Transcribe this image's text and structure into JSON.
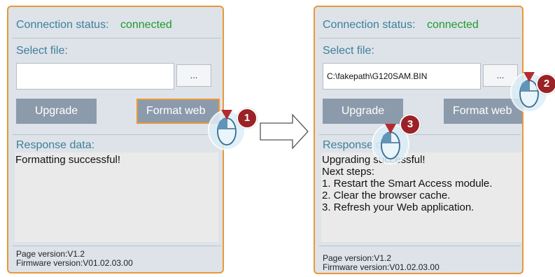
{
  "left_panel": {
    "connection_label": "Connection status:",
    "connection_value": "connected",
    "select_file_label": "Select file:",
    "file_input_value": "",
    "browse_label": "...",
    "upgrade_label": "Upgrade",
    "format_label": "Format web",
    "response_label": "Response data:",
    "response_lines": [
      "Formatting successful!"
    ],
    "page_version": "Page version:V1.2",
    "firmware_version": "Firmware version:V01.02.03.00",
    "step_badge": "1"
  },
  "right_panel": {
    "connection_label": "Connection status:",
    "connection_value": "connected",
    "select_file_label": "Select file:",
    "file_input_value": "C:\\fakepath\\G120SAM.BIN",
    "browse_label": "...",
    "upgrade_label": "Upgrade",
    "format_label": "Format web",
    "response_label": "Response data:",
    "response_lines": [
      "Upgrading successful!",
      "Next steps:",
      "1. Restart the Smart Access module.",
      "2. Clear the browser cache.",
      "3. Refresh your Web application."
    ],
    "page_version": "Page version:V1.2",
    "firmware_version": "Firmware version:V01.02.03.00",
    "browse_badge": "2",
    "upgrade_badge": "3"
  },
  "colors": {
    "panel_border": "#e8983a",
    "panel_bg": "#dde3e9",
    "label_text": "#3f7f9a",
    "connected_text": "#1f9a2e",
    "button_bg": "#8c9bab",
    "badge_bg": "#9b2226"
  },
  "icons": [
    "mouse-click-icon",
    "right-arrow-icon"
  ]
}
